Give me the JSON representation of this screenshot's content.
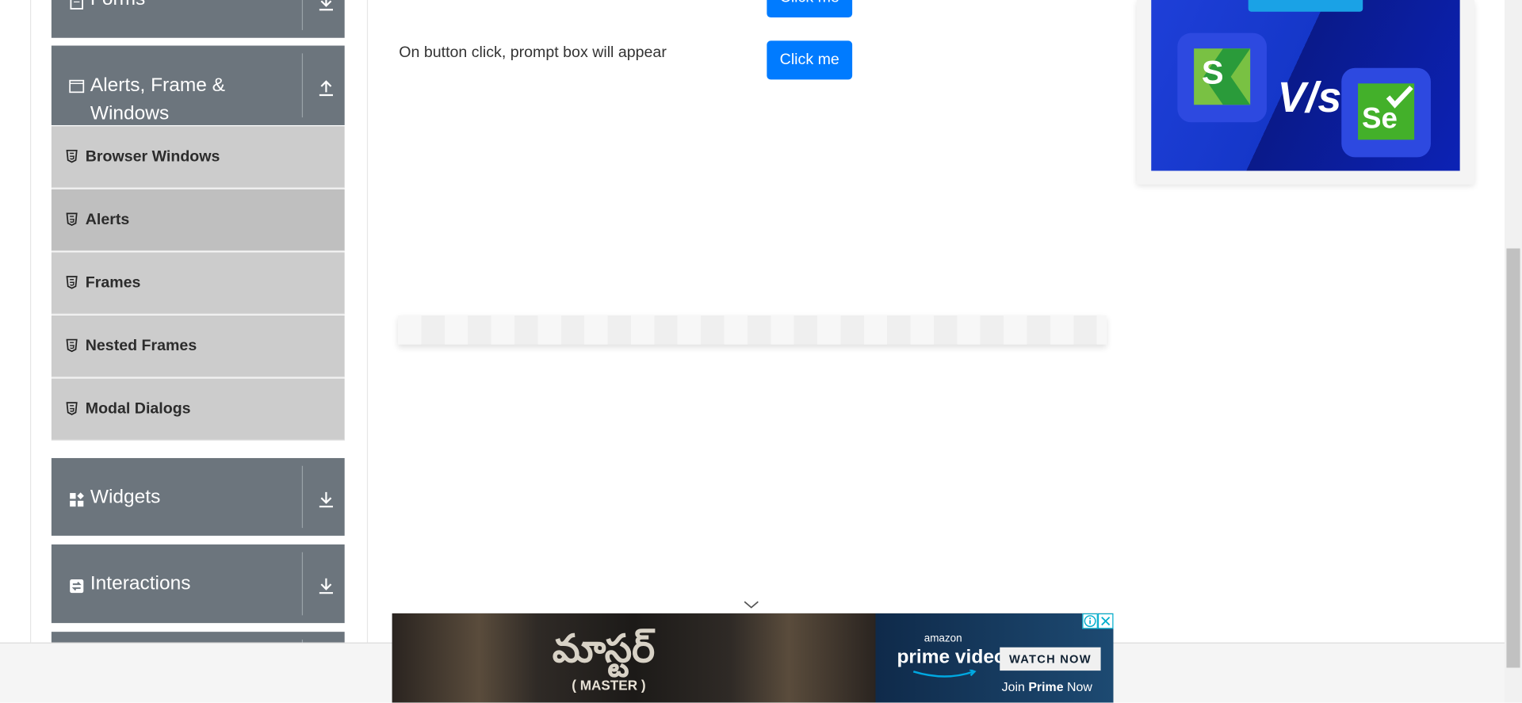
{
  "sidebar": {
    "forms_label": "Forms",
    "alerts_group_label_line1": "Alerts, Frame &",
    "alerts_group_label_line2": "Windows",
    "items": [
      {
        "label": "Browser Windows"
      },
      {
        "label": "Alerts"
      },
      {
        "label": "Frames"
      },
      {
        "label": "Nested Frames"
      },
      {
        "label": "Modal Dialogs"
      }
    ],
    "widgets_label": "Widgets",
    "interactions_label": "Interactions"
  },
  "main": {
    "prompt_row_text": "On button click, prompt box will appear",
    "button_label": "Click me"
  },
  "ad_right": {
    "vs_text": "V/s",
    "logo_s": "S",
    "logo_se": "Se"
  },
  "ad_bottom": {
    "movie_title": "మాస్టర్",
    "movie_subtitle": "( MASTER )",
    "brand_small": "amazon",
    "brand": "prime video",
    "watch_now": "WATCH NOW",
    "join_prefix": "Join ",
    "join_bold": "Prime",
    "join_suffix": " Now"
  },
  "colors": {
    "accent_blue": "#007bff",
    "sidebar_group": "#6c757d",
    "sidebar_item": "#cccccc"
  }
}
